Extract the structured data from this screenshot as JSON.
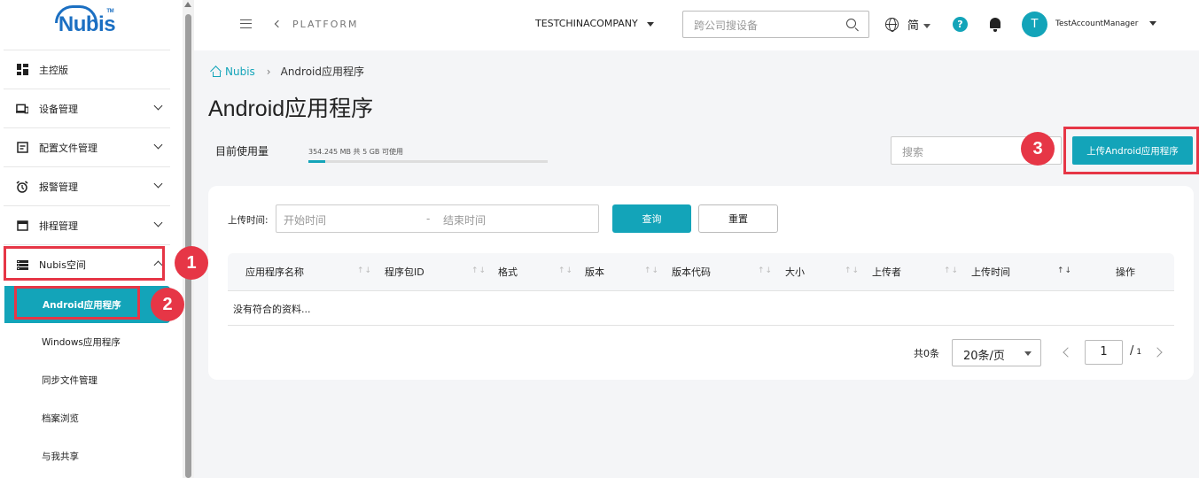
{
  "brand": {
    "logo_text": "Nubis",
    "logo_tm": "TM"
  },
  "sidebar": {
    "items": [
      {
        "label": "主控版",
        "icon": "dashboard-icon"
      },
      {
        "label": "设备管理",
        "icon": "devices-icon"
      },
      {
        "label": "配置文件管理",
        "icon": "profile-icon"
      },
      {
        "label": "报警管理",
        "icon": "alarm-clock-icon"
      },
      {
        "label": "排程管理",
        "icon": "calendar-icon"
      },
      {
        "label": "Nubis空间",
        "icon": "storage-icon"
      }
    ],
    "subitems": [
      {
        "label": "Android应用程序",
        "active": true
      },
      {
        "label": "Windows应用程序"
      },
      {
        "label": "同步文件管理"
      },
      {
        "label": "档案浏览"
      },
      {
        "label": "与我共享"
      }
    ]
  },
  "topbar": {
    "platform": "PLATFORM",
    "company": "TESTCHINACOMPANY",
    "search_placeholder": "跨公司搜设备",
    "language": "简",
    "help": "?",
    "avatar_initial": "T",
    "user": "TestAccountManager"
  },
  "breadcrumb": {
    "home": "Nubis",
    "current": "Android应用程序"
  },
  "page": {
    "title": "Android应用程序",
    "usage_label": "目前使用量",
    "usage_text": "354.245 MB 共 5 GB 可使用",
    "usage_fraction": 0.069,
    "search_placeholder": "搜索",
    "upload_button": "上传Android应用程序"
  },
  "filter": {
    "label": "上传时间:",
    "start_placeholder": "开始时间",
    "separator": "-",
    "end_placeholder": "结束时间",
    "query_button": "查询",
    "reset_button": "重置"
  },
  "table": {
    "columns": [
      "应用程序名称",
      "程序包ID",
      "格式",
      "版本",
      "版本代码",
      "大小",
      "上传者",
      "上传时间",
      "操作"
    ],
    "empty_text": "没有符合的资料..."
  },
  "pagination": {
    "total": "共0条",
    "page_size": "20条/页",
    "current_page": "1",
    "total_pages": "1"
  },
  "annotations": {
    "one": "1",
    "two": "2",
    "three": "3"
  },
  "colors": {
    "accent": "#13a4b9",
    "annotation": "#e63646",
    "brand": "#1b6fc2"
  }
}
